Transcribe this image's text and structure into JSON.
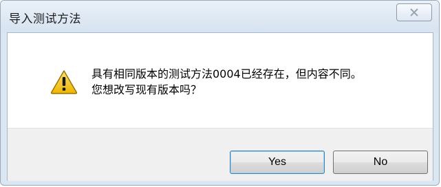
{
  "window": {
    "title": "导入测试方法",
    "close_icon": "close-icon"
  },
  "message": {
    "icon": "warning-icon",
    "line1": "具有相同版本的测试方法0004已经存在，但内容不同。",
    "line2": "您想改写现有版本吗？"
  },
  "buttons": {
    "yes_label": "Yes",
    "no_label": "No"
  },
  "colors": {
    "titlebar": "#dbe6f3",
    "warning_fill": "#f6c619",
    "warning_border": "#9a7400"
  }
}
